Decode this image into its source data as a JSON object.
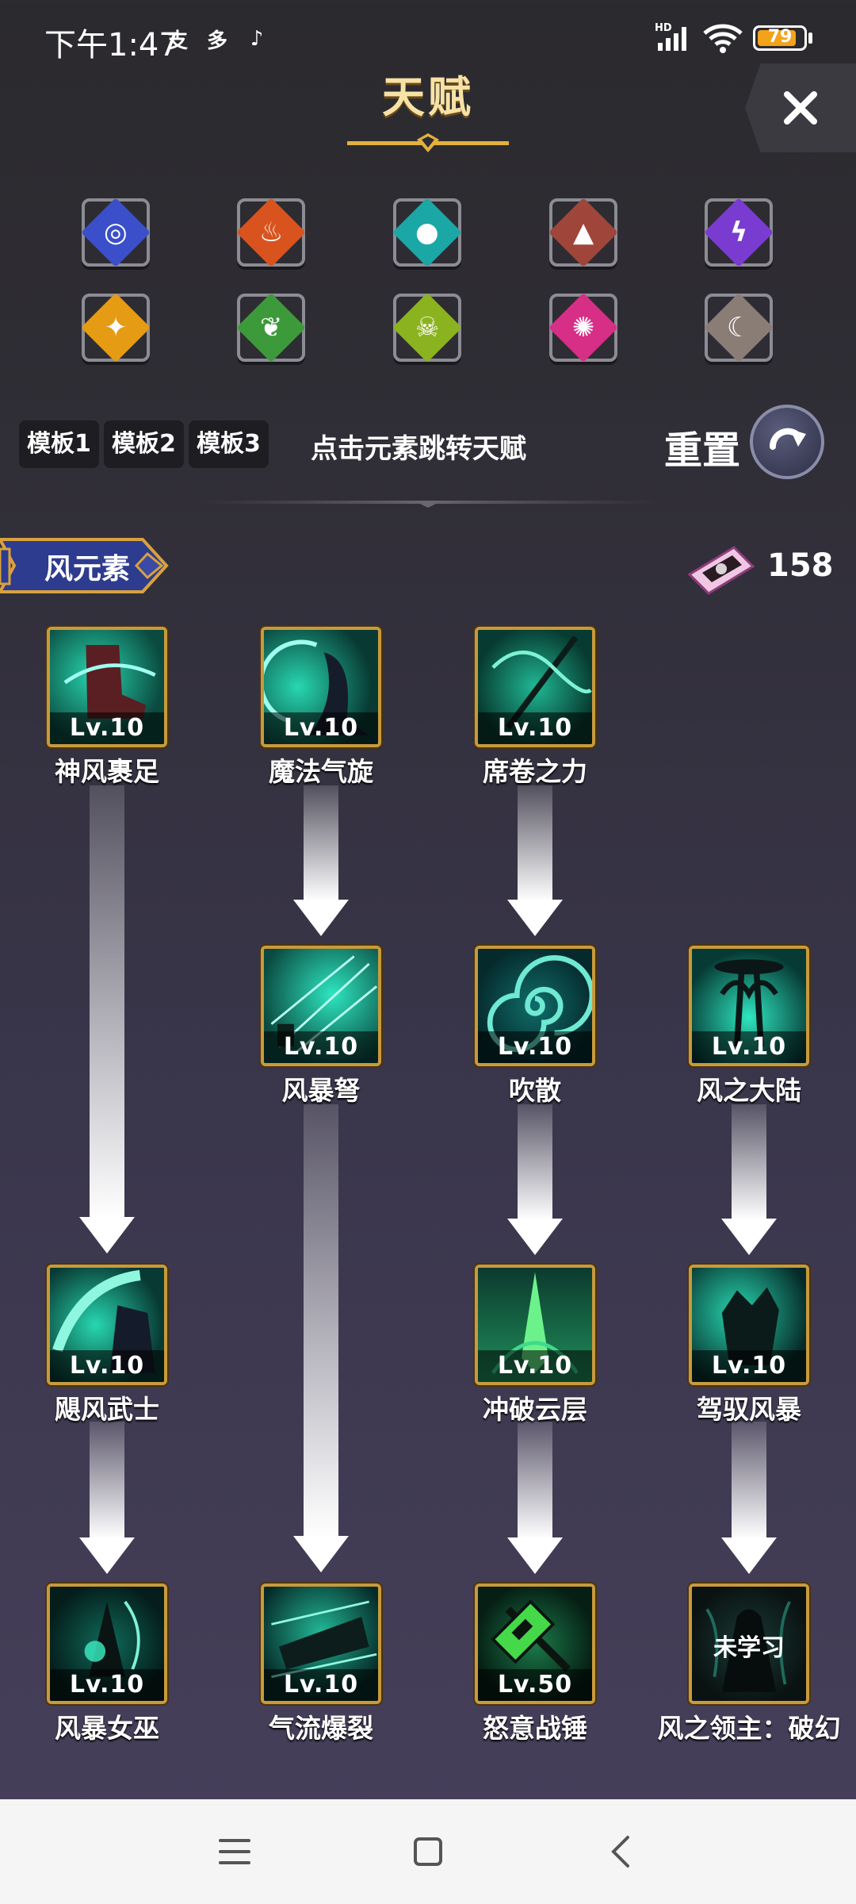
{
  "status_bar": {
    "time": "下午1:47",
    "apps": [
      {
        "icon": "alipay-icon",
        "glyph": "支",
        "color": "#1677ff"
      },
      {
        "icon": "pinduoduo-icon",
        "glyph": "多",
        "color": "#e8383d"
      },
      {
        "icon": "qq-music-icon",
        "glyph": "♪",
        "color": "#f5c518"
      }
    ],
    "network": "HD",
    "battery": 79
  },
  "title": "天赋",
  "elements": [
    {
      "name": "wind-element-icon",
      "glyph": "◎",
      "color": "#3a4fc9"
    },
    {
      "name": "fire-element-icon",
      "glyph": "♨",
      "color": "#d9531e"
    },
    {
      "name": "water-element-icon",
      "glyph": "●",
      "color": "#1aa7a5"
    },
    {
      "name": "earth-element-icon",
      "glyph": "▲",
      "color": "#a0453a"
    },
    {
      "name": "lightning-element-icon",
      "glyph": "ϟ",
      "color": "#7a3bd1"
    },
    {
      "name": "light-element-icon",
      "glyph": "✦",
      "color": "#e59b14"
    },
    {
      "name": "nature-element-icon",
      "glyph": "❦",
      "color": "#3d9a3a"
    },
    {
      "name": "poison-element-icon",
      "glyph": "☠",
      "color": "#8bb31f"
    },
    {
      "name": "holy-element-icon",
      "glyph": "✺",
      "color": "#d72e86"
    },
    {
      "name": "dark-element-icon",
      "glyph": "☾",
      "color": "#8a7d76"
    }
  ],
  "templates": [
    "模板1",
    "模板2",
    "模板3"
  ],
  "hint": "点击元素跳转天赋",
  "reset_label": "重置",
  "current_element": "风元素",
  "points": "158",
  "skills": [
    {
      "key": "shenfeng",
      "name": "神风裹足",
      "level": "Lv.10"
    },
    {
      "key": "mofa",
      "name": "魔法气旋",
      "level": "Lv.10"
    },
    {
      "key": "xijuan",
      "name": "席卷之力",
      "level": "Lv.10"
    },
    {
      "key": "fengbaonu",
      "name": "风暴弩",
      "level": "Lv.10"
    },
    {
      "key": "chuisan",
      "name": "吹散",
      "level": "Lv.10"
    },
    {
      "key": "fengzhi",
      "name": "风之大陆",
      "level": "Lv.10"
    },
    {
      "key": "jufeng",
      "name": "飓风武士",
      "level": "Lv.10"
    },
    {
      "key": "chongpo",
      "name": "冲破云层",
      "level": "Lv.10"
    },
    {
      "key": "jiayu",
      "name": "驾驭风暴",
      "level": "Lv.10"
    },
    {
      "key": "nvwu",
      "name": "风暴女巫",
      "level": "Lv.10"
    },
    {
      "key": "qiliu",
      "name": "气流爆裂",
      "level": "Lv.10"
    },
    {
      "key": "nuyi",
      "name": "怒意战锤",
      "level": "Lv.50"
    },
    {
      "key": "lingzhu",
      "name": "风之领主：破幻",
      "level": "",
      "locked_label": "未学习"
    }
  ],
  "nav": [
    "menu-icon",
    "home-icon",
    "back-icon"
  ]
}
